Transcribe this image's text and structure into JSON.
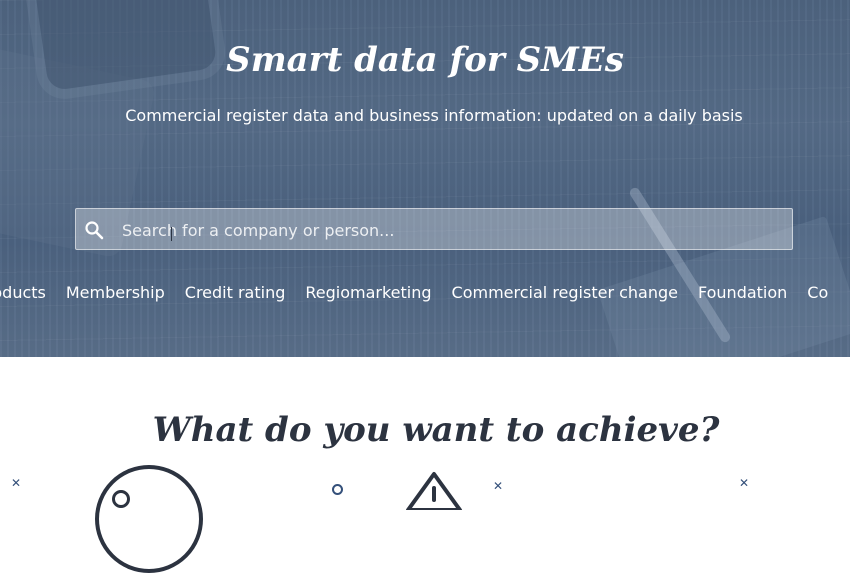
{
  "hero": {
    "title": "Smart data for SMEs",
    "subtitle": "Commercial register data and business information: updated on a daily basis"
  },
  "search": {
    "placeholder": "Search for a company or person...",
    "value": "",
    "icon": "search-icon"
  },
  "nav": {
    "items": [
      {
        "label": "products"
      },
      {
        "label": "Membership"
      },
      {
        "label": "Credit rating"
      },
      {
        "label": "Regiomarketing"
      },
      {
        "label": "Commercial register change"
      },
      {
        "label": "Foundation"
      },
      {
        "label": "Co"
      }
    ]
  },
  "section": {
    "title": "What do you want to achieve?"
  },
  "colors": {
    "hero_overlay": "#566c88",
    "heading_dark": "#2c3340",
    "accent": "#34507a"
  }
}
